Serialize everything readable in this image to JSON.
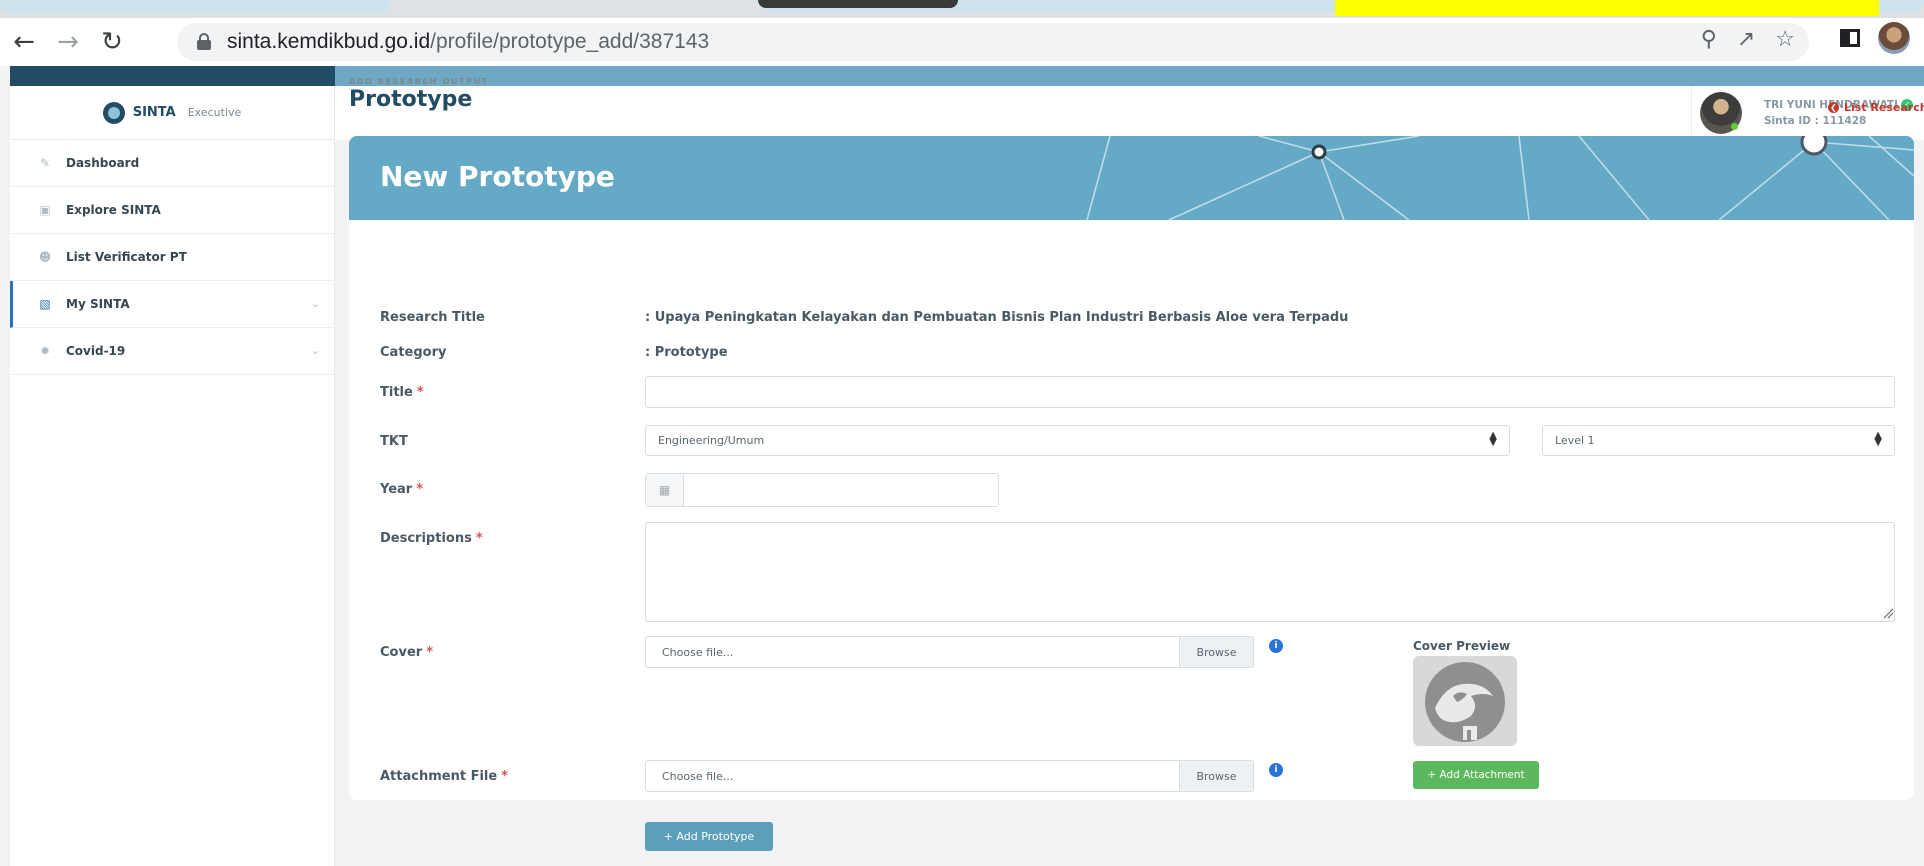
{
  "browser": {
    "url_host": "sinta.kemdikbud.go.id",
    "url_path": "/profile/prototype_add/387143"
  },
  "sidebar": {
    "brand_name": "SINTA",
    "brand_sub": "Executive",
    "items": [
      {
        "label": "Dashboard",
        "icon": "pencil-icon"
      },
      {
        "label": "Explore SINTA",
        "icon": "document-icon"
      },
      {
        "label": "List Verificator PT",
        "icon": "user-circle-icon"
      },
      {
        "label": "My SINTA",
        "icon": "id-card-icon",
        "active": true
      },
      {
        "label": "Covid-19",
        "icon": "virus-icon"
      }
    ]
  },
  "user": {
    "name": "TRI YUNI HENDRAWATI",
    "sinta_id": "Sinta ID : 111428"
  },
  "page": {
    "eyebrow": "ADD RESEARCH OUTPUT",
    "title": "Prototype",
    "list_link": "List Research"
  },
  "card": {
    "title": "New Prototype"
  },
  "form": {
    "research_title_label": "Research Title",
    "research_title_value": ":  Upaya Peningkatan Kelayakan dan Pembuatan Bisnis Plan Industri Berbasis Aloe vera Terpadu",
    "category_label": "Category",
    "category_value": ":  Prototype",
    "title_label": "Title",
    "title_value": "",
    "tkt_label": "TKT",
    "tkt_field_selected": "Engineering/Umum",
    "tkt_level_selected": "Level 1",
    "year_label": "Year",
    "year_value": "",
    "descriptions_label": "Descriptions",
    "descriptions_value": "",
    "cover_label": "Cover",
    "cover_placeholder": "Choose file...",
    "browse_label": "Browse",
    "cover_preview_label": "Cover Preview",
    "attachment_label": "Attachment File",
    "attachment_placeholder": "Choose file...",
    "add_attachment_label": "+ Add Attachment",
    "add_prototype_label": "+ Add Prototype",
    "required_mark": "*"
  },
  "colors": {
    "card_header": "#64a9c5",
    "sidebar_dark": "#214c63",
    "add_attachment": "#5cb85c",
    "add_prototype": "#5b9fbb",
    "required": "#d9534f"
  }
}
